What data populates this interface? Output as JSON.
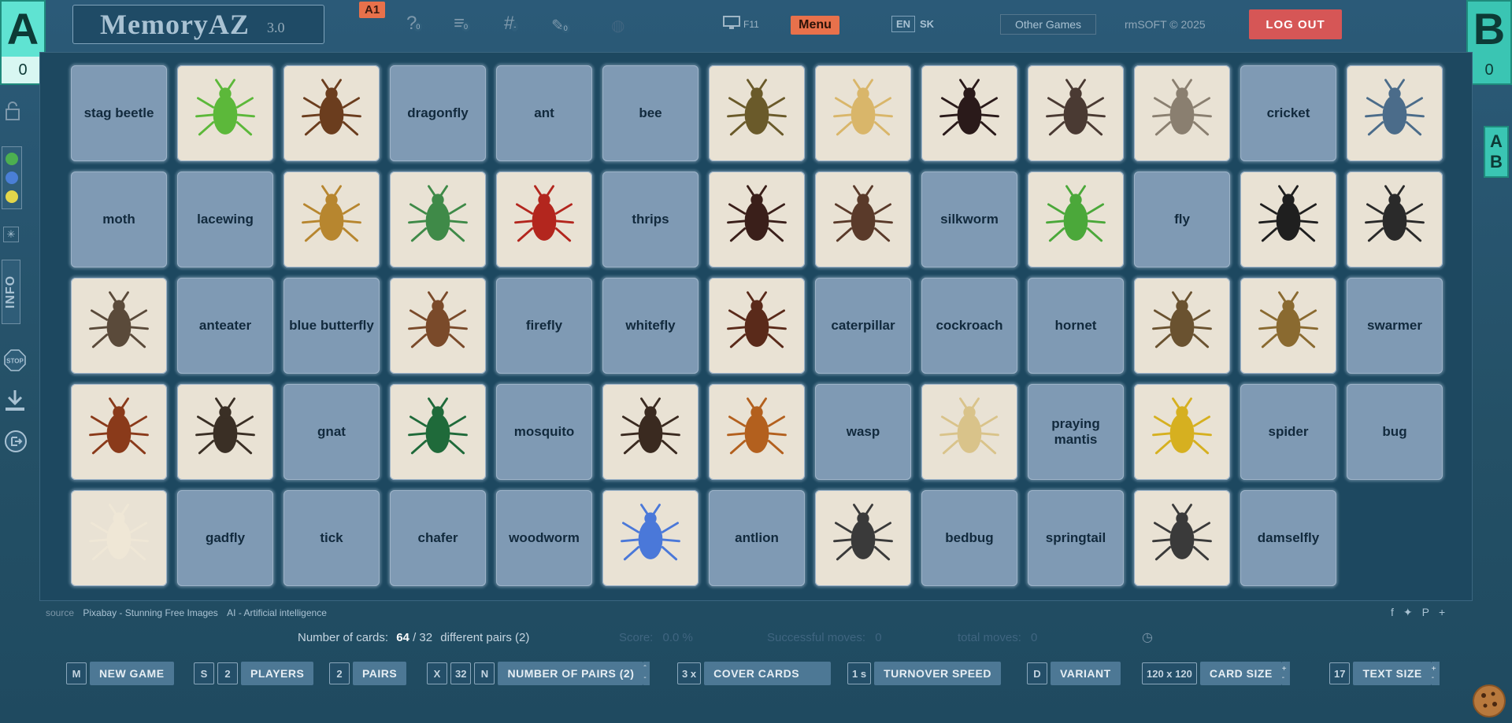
{
  "header": {
    "logo_text": "MemoryAZ",
    "logo_version": "3.0",
    "badge": "A1",
    "icons": [
      {
        "name": "help-icon",
        "glyph": "?",
        "count": "0"
      },
      {
        "name": "list-icon",
        "glyph": "≡",
        "count": "0"
      },
      {
        "name": "hash-icon",
        "glyph": "#",
        "count": "-"
      },
      {
        "name": "puzzle-icon",
        "glyph": "✎",
        "count": "0"
      }
    ],
    "fullscreen_label": "F11",
    "menu_label": "Menu",
    "lang_en": "EN",
    "lang_sk": "SK",
    "other_games_label": "Other Games",
    "copyright": "rmSOFT © 2025",
    "logout_label": "LOG OUT"
  },
  "players": {
    "a": {
      "letter": "A",
      "score": "0"
    },
    "b": {
      "letter": "B",
      "score": "0"
    },
    "ab_badge": [
      "A",
      "B"
    ]
  },
  "sidebar": {
    "info_label": "INFO",
    "colors": [
      "#4caf50",
      "#4a7fd6",
      "#e3d64b"
    ]
  },
  "board": {
    "rows": [
      [
        {
          "type": "text",
          "label": "stag beetle"
        },
        {
          "type": "img",
          "icon": "caterpillar-icon",
          "color": "#5cb83a"
        },
        {
          "type": "img",
          "icon": "cockroach-icon",
          "color": "#6b3d1e"
        },
        {
          "type": "text",
          "label": "dragonfly"
        },
        {
          "type": "text",
          "label": "ant"
        },
        {
          "type": "text",
          "label": "bee"
        },
        {
          "type": "img",
          "icon": "bug-icon",
          "color": "#6a5a2a"
        },
        {
          "type": "img",
          "icon": "thrips-icon",
          "color": "#d9b66a"
        },
        {
          "type": "img",
          "icon": "butterfly-icon",
          "color": "#2a1a1a"
        },
        {
          "type": "img",
          "icon": "fly-icon",
          "color": "#4a3a33"
        },
        {
          "type": "img",
          "icon": "moth-icon",
          "color": "#8a7f70"
        },
        {
          "type": "text",
          "label": "cricket"
        },
        {
          "type": "img",
          "icon": "dragonfly-icon",
          "color": "#4b6c8a"
        }
      ],
      [
        {
          "type": "text",
          "label": "moth"
        },
        {
          "type": "text",
          "label": "lacewing"
        },
        {
          "type": "img",
          "icon": "bee-icon",
          "color": "#b7862f"
        },
        {
          "type": "img",
          "icon": "fly-icon",
          "color": "#3f8a48"
        },
        {
          "type": "img",
          "icon": "wasp-icon",
          "color": "#b3261e"
        },
        {
          "type": "text",
          "label": "thrips"
        },
        {
          "type": "img",
          "icon": "ant-icon",
          "color": "#3a1f1a"
        },
        {
          "type": "img",
          "icon": "mosquito-icon",
          "color": "#5a3a2a"
        },
        {
          "type": "text",
          "label": "silkworm"
        },
        {
          "type": "img",
          "icon": "mantis-icon",
          "color": "#4ba83a"
        },
        {
          "type": "text",
          "label": "fly"
        },
        {
          "type": "img",
          "icon": "stag-beetle-icon",
          "color": "#1f1f1f"
        },
        {
          "type": "img",
          "icon": "firefly-icon",
          "color": "#2a2a2a"
        }
      ],
      [
        {
          "type": "img",
          "icon": "gadfly-icon",
          "color": "#5a4a3a"
        },
        {
          "type": "text",
          "label": "anteater"
        },
        {
          "type": "text",
          "label": "blue butterfly"
        },
        {
          "type": "img",
          "icon": "chafer-icon",
          "color": "#7a4a2a"
        },
        {
          "type": "text",
          "label": "firefly"
        },
        {
          "type": "text",
          "label": "whitefly"
        },
        {
          "type": "img",
          "icon": "tick-icon",
          "color": "#5a2a1a"
        },
        {
          "type": "text",
          "label": "caterpillar"
        },
        {
          "type": "text",
          "label": "cockroach"
        },
        {
          "type": "text",
          "label": "hornet"
        },
        {
          "type": "img",
          "icon": "spider-icon",
          "color": "#6a5230"
        },
        {
          "type": "img",
          "icon": "antlion-icon",
          "color": "#8a6a30"
        },
        {
          "type": "text",
          "label": "swarmer"
        }
      ],
      [
        {
          "type": "img",
          "icon": "bedbug-icon",
          "color": "#8a3a1a"
        },
        {
          "type": "img",
          "icon": "woodworm-icon",
          "color": "#3a2f25"
        },
        {
          "type": "text",
          "label": "gnat"
        },
        {
          "type": "img",
          "icon": "beetle-icon",
          "color": "#1f6a3a"
        },
        {
          "type": "text",
          "label": "mosquito"
        },
        {
          "type": "img",
          "icon": "springtail-icon",
          "color": "#3a2a20"
        },
        {
          "type": "img",
          "icon": "hornet-icon",
          "color": "#b3601e"
        },
        {
          "type": "text",
          "label": "wasp"
        },
        {
          "type": "img",
          "icon": "silkworm-moth-icon",
          "color": "#d9c38a"
        },
        {
          "type": "text",
          "label": "praying mantis"
        },
        {
          "type": "img",
          "icon": "wasp-icon",
          "color": "#d6b020"
        },
        {
          "type": "text",
          "label": "spider"
        },
        {
          "type": "text",
          "label": "bug"
        }
      ],
      [
        {
          "type": "img",
          "icon": "whitefly-icon",
          "color": "#efe7d6"
        },
        {
          "type": "text",
          "label": "gadfly"
        },
        {
          "type": "text",
          "label": "tick"
        },
        {
          "type": "text",
          "label": "chafer"
        },
        {
          "type": "text",
          "label": "woodworm"
        },
        {
          "type": "img",
          "icon": "blue-butterfly-icon",
          "color": "#4a78d9"
        },
        {
          "type": "text",
          "label": "antlion"
        },
        {
          "type": "img",
          "icon": "gnat-icon",
          "color": "#3a3a3a"
        },
        {
          "type": "text",
          "label": "bedbug"
        },
        {
          "type": "text",
          "label": "springtail"
        },
        {
          "type": "img",
          "icon": "lacewing-icon",
          "color": "#3a3a3a"
        },
        {
          "type": "text",
          "label": "damselfly"
        }
      ]
    ]
  },
  "footer": {
    "source_label": "source",
    "source_links": [
      "Pixabay - Stunning Free Images",
      "AI - Artificial intelligence"
    ],
    "cards_label": "Number of cards:",
    "cards_value": "64",
    "pairs_value": "/ 32",
    "pairs_label": "different pairs (2)",
    "score_label": "Score:",
    "score_value": "0.0 %",
    "successful_label": "Successful moves:",
    "successful_value": "0",
    "total_label": "total moves:",
    "total_value": "0"
  },
  "toolbar": {
    "new_game": {
      "key": "M",
      "label": "NEW GAME"
    },
    "players": {
      "key": "S",
      "value": "2",
      "label": "PLAYERS"
    },
    "pairs": {
      "value": "2",
      "label": "PAIRS"
    },
    "num_pairs": {
      "key1": "X",
      "value": "32",
      "key2": "N",
      "label": "NUMBER OF PAIRS (2)"
    },
    "cover": {
      "value": "3 x",
      "label": "COVER CARDS"
    },
    "speed": {
      "value": "1 s",
      "label": "TURNOVER SPEED"
    },
    "variant": {
      "key": "D",
      "label": "VARIANT"
    },
    "card_size": {
      "value": "120 x 120",
      "label": "CARD SIZE"
    },
    "text_size": {
      "value": "17",
      "label": "TEXT SIZE"
    }
  }
}
